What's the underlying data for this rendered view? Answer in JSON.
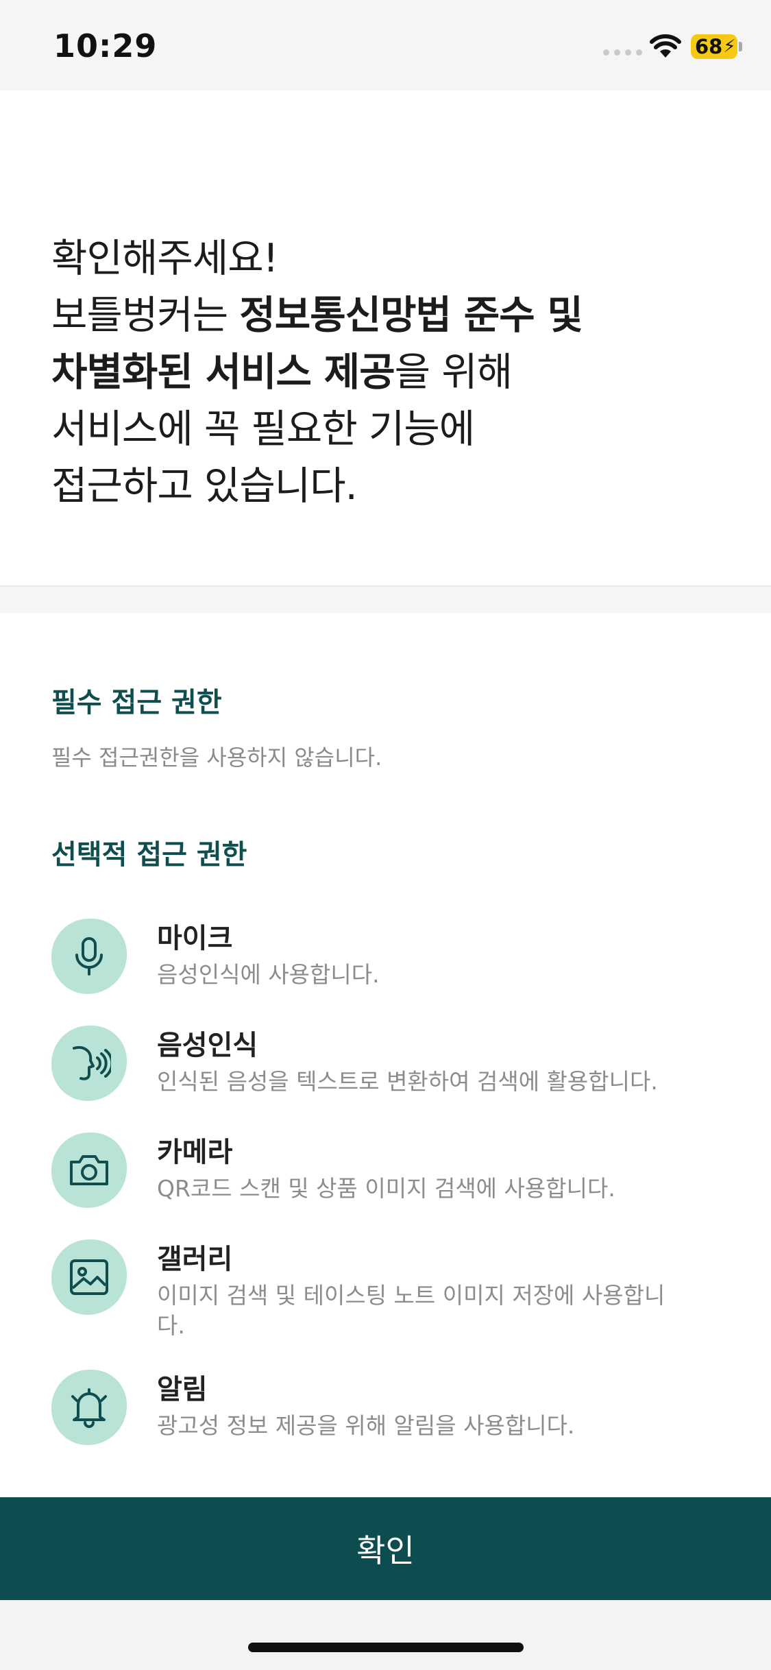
{
  "status_bar": {
    "time": "10:29",
    "battery": "68"
  },
  "headline": {
    "line1": "확인해주세요!",
    "line2_prefix": "보틀벙커는 ",
    "line2_bold": "정보통신망법 준수 및",
    "line3_bold": "차별화된 서비스 제공",
    "line3_suffix": "을 위해",
    "line4": "서비스에 꼭 필요한 기능에",
    "line5": "접근하고 있습니다."
  },
  "required": {
    "title": "필수 접근 권한",
    "description": "필수 접근권한을 사용하지 않습니다."
  },
  "optional": {
    "title": "선택적 접근 권한",
    "items": [
      {
        "icon": "microphone-icon",
        "title": "마이크",
        "description": "음성인식에 사용합니다."
      },
      {
        "icon": "voice-recognition-icon",
        "title": "음성인식",
        "description": "인식된 음성을 텍스트로 변환하여 검색에 활용합니다."
      },
      {
        "icon": "camera-icon",
        "title": "카메라",
        "description": "QR코드 스캔 및 상품 이미지 검색에 사용합니다."
      },
      {
        "icon": "gallery-icon",
        "title": "갤러리",
        "description": "이미지 검색 및 테이스팅 노트 이미지 저장에 사용합니다."
      },
      {
        "icon": "bell-icon",
        "title": "알림",
        "description": "광고성 정보 제공을 위해 알림을 사용합니다."
      }
    ]
  },
  "confirm_button": {
    "label": "확인"
  },
  "colors": {
    "accent": "#0d4d4f",
    "icon_bg": "#b8e3d6",
    "section_title": "#0f4d4f"
  }
}
